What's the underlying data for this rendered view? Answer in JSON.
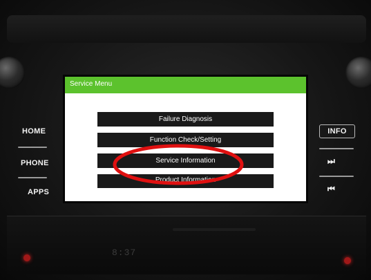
{
  "hardware": {
    "home_label": "HOME",
    "phone_label": "PHONE",
    "apps_label": "APPS",
    "info_label": "INFO",
    "next_symbol": "⏭",
    "prev_symbol": "⏮",
    "clock": "8:37"
  },
  "screen": {
    "title": "Service Menu",
    "title_bar_color": "#5cc22d",
    "menu_items": [
      {
        "label": "Failure Diagnosis"
      },
      {
        "label": "Function Check/Setting"
      },
      {
        "label": "Service Information"
      },
      {
        "label": "Product Information"
      }
    ]
  },
  "annotation": {
    "color": "#e01010",
    "highlighted_item": "Service Information"
  },
  "colors": {
    "indicator": "#a01818",
    "menu_button": "#1a1a1a"
  }
}
